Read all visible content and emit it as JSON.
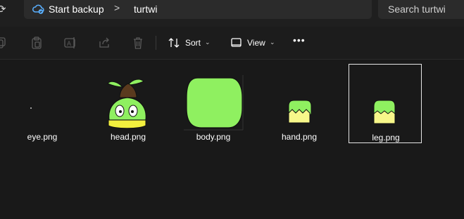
{
  "address": {
    "crumbs": [
      "Start backup",
      "turtwi"
    ],
    "separator": ">",
    "crumb_icon": "cloud-sync-icon"
  },
  "search": {
    "placeholder": "Search turtwi"
  },
  "toolbar": {
    "icons": [
      "copy-icon",
      "paste-icon",
      "rename-icon",
      "share-icon",
      "delete-icon"
    ],
    "sort_label": "Sort",
    "view_label": "View",
    "more_label": "•••"
  },
  "files": [
    {
      "name": "eye.png",
      "icon": "eye-thumbnail"
    },
    {
      "name": "head.png",
      "icon": "head-thumbnail"
    },
    {
      "name": "body.png",
      "icon": "body-thumbnail"
    },
    {
      "name": "hand.png",
      "icon": "hand-thumbnail"
    },
    {
      "name": "leg.png",
      "icon": "leg-thumbnail",
      "selected": true
    }
  ],
  "colors": {
    "background": "#191919",
    "toolbar": "#1c1c1c",
    "address_bar": "#2b2b2b",
    "thumb_green": "#8ff060",
    "thumb_yellow": "#f7f78a",
    "head_brown": "#5a3a1e"
  }
}
